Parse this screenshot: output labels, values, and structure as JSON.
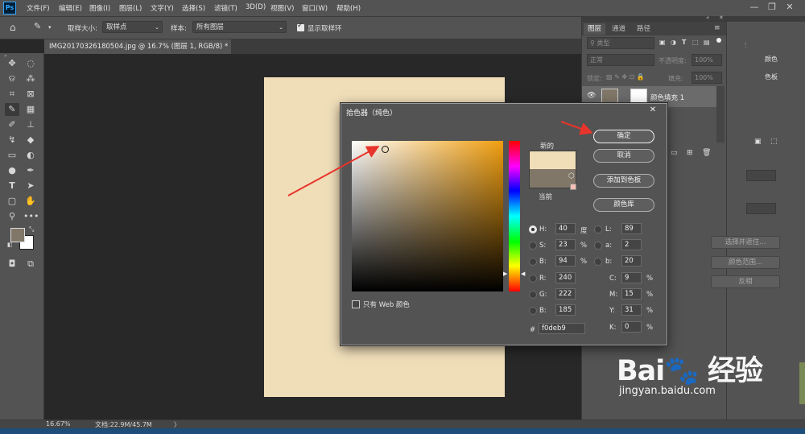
{
  "app": {
    "logo_text": "Ps"
  },
  "menu": [
    "文件(F)",
    "编辑(E)",
    "图像(I)",
    "图层(L)",
    "文字(Y)",
    "选择(S)",
    "滤镜(T)",
    "3D(D)",
    "视图(V)",
    "窗口(W)",
    "帮助(H)"
  ],
  "window_controls": {
    "minimize": "—",
    "restore": "❐",
    "close": "✕"
  },
  "options_bar": {
    "sample_size_label": "取样大小:",
    "sample_size_value": "取样点",
    "sample_label": "样本:",
    "sample_value": "所有图层",
    "show_ring_label": "显示取样环",
    "show_ring_checked": true
  },
  "document_tab": {
    "title": "IMG20170326180504.jpg @ 16.7% (图层 1, RGB/8) *",
    "close": "✕"
  },
  "document": {
    "fill_color": "#f0deb9"
  },
  "statusbar": {
    "zoom": "16.67%",
    "doc_info": "文档:22.9M/45.7M",
    "arrow": "〉"
  },
  "tools": [
    "move-icon",
    "marquee-icon",
    "lasso-icon",
    "magic-wand-icon",
    "crop-icon",
    "frame-icon",
    "eyedropper-icon",
    "healing-brush-icon",
    "brush-icon",
    "stamp-icon",
    "history-brush-icon",
    "eraser-icon",
    "gradient-icon",
    "blur-icon",
    "dodge-icon",
    "pen-icon",
    "type-icon",
    "path-selection-icon",
    "rectangle-icon",
    "hand-icon",
    "zoom-icon",
    "more-tools-icon"
  ],
  "layers_panel": {
    "tabs": [
      "图层",
      "通道",
      "路径"
    ],
    "search_placeholder": "类型",
    "blend_mode": "正常",
    "opacity_label": "不透明度:",
    "opacity_value": "100%",
    "lock_label": "锁定:",
    "fill_label": "填充:",
    "fill_value": "100%",
    "layer_name": "颜色填充 1"
  },
  "right_panel": {
    "adjust_label": "颜色",
    "color_label": "色板",
    "select_and_mask": "选择并遮住...",
    "color_range": "颜色范围...",
    "invert": "反相"
  },
  "color_picker": {
    "title": "拾色器（纯色）",
    "close": "✕",
    "label_new": "新的",
    "label_current": "当前",
    "new_color": "#f0deb9",
    "current_color": "#807768",
    "hue_deg": 40,
    "buttons": {
      "ok": "确定",
      "cancel": "取消",
      "add_to_swatches": "添加到色板",
      "color_libraries": "颜色库"
    },
    "web_only_label": "只有 Web 颜色",
    "web_only_checked": false,
    "hsb": [
      {
        "key": "H:",
        "value": "40",
        "unit": "度",
        "selected": true
      },
      {
        "key": "S:",
        "value": "23",
        "unit": "%",
        "selected": false
      },
      {
        "key": "B:",
        "value": "94",
        "unit": "%",
        "selected": false
      }
    ],
    "rgb": [
      {
        "key": "R:",
        "value": "240"
      },
      {
        "key": "G:",
        "value": "222"
      },
      {
        "key": "B:",
        "value": "185"
      }
    ],
    "lab": [
      {
        "key": "L:",
        "value": "89"
      },
      {
        "key": "a:",
        "value": "2"
      },
      {
        "key": "b:",
        "value": "20"
      }
    ],
    "cmyk": [
      {
        "key": "C:",
        "value": "9",
        "unit": "%"
      },
      {
        "key": "M:",
        "value": "15",
        "unit": "%"
      },
      {
        "key": "Y:",
        "value": "31",
        "unit": "%"
      },
      {
        "key": "K:",
        "value": "0",
        "unit": "%"
      }
    ],
    "hex_label": "#",
    "hex_value": "f0deb9"
  },
  "watermark": {
    "logo": "Bai🐾 经验",
    "url": "jingyan.baidu.com"
  }
}
